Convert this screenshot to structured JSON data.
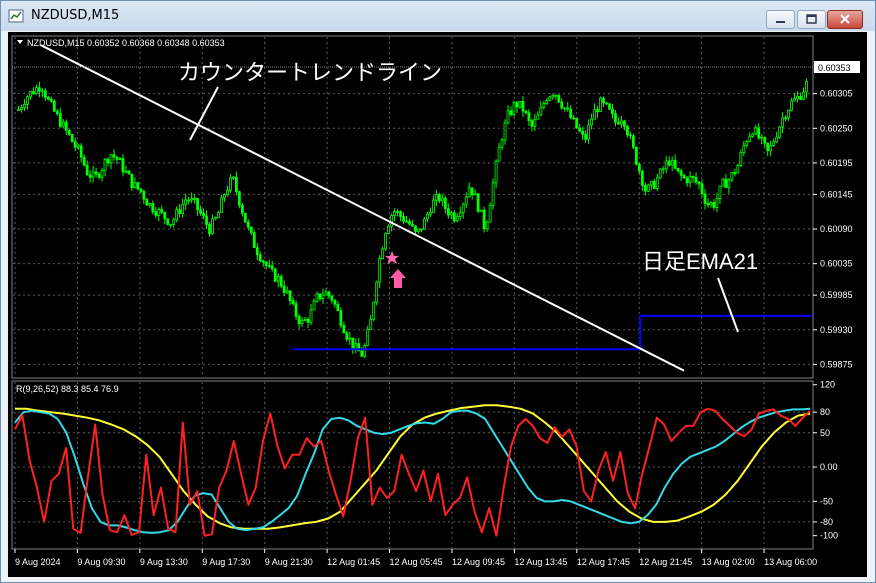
{
  "window": {
    "title": "NZDUSD,M15"
  },
  "colors": {
    "bull": "#00ff00",
    "trendline": "#ffffff",
    "ema": "#0000ff",
    "rsi_fast": "#ff2020",
    "rsi_mid": "#33d9e8",
    "rsi_slow": "#ffff33",
    "grid": "#5a5a5a",
    "marker_star": "#ff69b4",
    "marker_arrow": "#ff5aa5"
  },
  "main_chart": {
    "header": "NZDUSD,M15  0.60352 0.60368 0.60348 0.60353",
    "current_price": "0.60353",
    "price_ticks": [
      "0.60305",
      "0.60250",
      "0.60195",
      "0.60145",
      "0.60090",
      "0.60035",
      "0.59985",
      "0.59930",
      "0.59875"
    ],
    "annotation_trend": "カウンタートレンドライン",
    "annotation_ema": "日足EMA21"
  },
  "sub_chart": {
    "header": "R(9,26,52) 88.3 85.4 76.9",
    "ticks": [
      "120",
      "80",
      "50",
      "0.00",
      "-50",
      "-80",
      "-100"
    ]
  },
  "time_axis": [
    "9 Aug 2024",
    "9 Aug 09:30",
    "9 Aug 13:30",
    "9 Aug 17:30",
    "9 Aug 21:30",
    "12 Aug 01:45",
    "12 Aug 05:45",
    "12 Aug 09:45",
    "12 Aug 13:45",
    "12 Aug 17:45",
    "12 Aug 21:45",
    "13 Aug 02:00",
    "13 Aug 06:00"
  ],
  "chart_data": {
    "type": "candlestick",
    "symbol": "NZDUSD",
    "timeframe": "M15",
    "y_range": [
      0.59855,
      0.60395
    ],
    "close_series": [
      0.6028,
      0.603,
      0.6031,
      0.6032,
      0.6029,
      0.6027,
      0.6025,
      0.6023,
      0.6021,
      0.6018,
      0.6017,
      0.6019,
      0.6021,
      0.602,
      0.6018,
      0.6016,
      0.6015,
      0.6013,
      0.6012,
      0.6011,
      0.601,
      0.6012,
      0.6014,
      0.6013,
      0.6011,
      0.6009,
      0.6011,
      0.6015,
      0.6017,
      0.6013,
      0.6009,
      0.6006,
      0.6004,
      0.6002,
      0.6001,
      0.5999,
      0.5996,
      0.5994,
      0.5995,
      0.5998,
      0.5999,
      0.5998,
      0.5995,
      0.5992,
      0.599,
      0.5989,
      0.5994,
      0.6003,
      0.6009,
      0.6012,
      0.6011,
      0.601,
      0.6008,
      0.601,
      0.6013,
      0.6014,
      0.6012,
      0.6011,
      0.6013,
      0.6016,
      0.6013,
      0.6009,
      0.6016,
      0.6023,
      0.6027,
      0.6029,
      0.6028,
      0.6025,
      0.6027,
      0.603,
      0.6031,
      0.6029,
      0.6027,
      0.6025,
      0.6023,
      0.6027,
      0.6029,
      0.6028,
      0.6026,
      0.6027,
      0.6023,
      0.6019,
      0.6015,
      0.6016,
      0.6018,
      0.602,
      0.6018,
      0.6017,
      0.6017,
      0.6016,
      0.6013,
      0.6013,
      0.6016,
      0.6017,
      0.6019,
      0.6023,
      0.6025,
      0.6023,
      0.6021,
      0.6024,
      0.6027,
      0.6029,
      0.603,
      0.6032
    ],
    "ema_steps": [
      {
        "from": 0.35,
        "to": 0.785,
        "value": 0.59899
      },
      {
        "from": 0.785,
        "to": 1.0,
        "value": 0.59952
      }
    ],
    "trendline": {
      "start": 0.60382,
      "end": 0.59865
    },
    "rsi": {
      "fast": [
        55,
        76,
        10,
        -30,
        -80,
        -20,
        -10,
        28,
        -90,
        -96,
        -15,
        62,
        -40,
        -92,
        -95,
        -70,
        -99,
        -95,
        18,
        -70,
        -30,
        -90,
        -95,
        65,
        -55,
        -35,
        -100,
        -98,
        -30,
        -5,
        38,
        -10,
        -55,
        -30,
        38,
        78,
        30,
        -2,
        18,
        18,
        42,
        30,
        38,
        -5,
        -40,
        -72,
        -20,
        42,
        72,
        -55,
        -30,
        -45,
        -35,
        18,
        -10,
        -35,
        -5,
        -50,
        -10,
        -70,
        -55,
        -45,
        -15,
        -65,
        -95,
        -60,
        -100,
        -30,
        30,
        60,
        70,
        60,
        42,
        35,
        58,
        44,
        55,
        30,
        -35,
        -50,
        -5,
        22,
        -20,
        22,
        -38,
        -60,
        -10,
        30,
        72,
        62,
        38,
        50,
        60,
        60,
        80,
        85,
        82,
        70,
        60,
        50,
        45,
        55,
        78,
        82,
        84,
        75,
        70,
        60,
        72,
        82
      ],
      "mid": [
        65,
        80,
        82,
        80,
        78,
        70,
        50,
        15,
        -25,
        -60,
        -80,
        -85,
        -85,
        -88,
        -92,
        -95,
        -96,
        -95,
        -92,
        -80,
        -60,
        -42,
        -38,
        -40,
        -60,
        -80,
        -90,
        -92,
        -90,
        -88,
        -80,
        -70,
        -60,
        -42,
        -10,
        20,
        55,
        70,
        72,
        68,
        60,
        55,
        50,
        48,
        50,
        55,
        60,
        64,
        65,
        63,
        70,
        80,
        82,
        82,
        78,
        70,
        50,
        30,
        10,
        -10,
        -30,
        -45,
        -50,
        -50,
        -48,
        -50,
        -55,
        -60,
        -65,
        -70,
        -75,
        -80,
        -82,
        -80,
        -70,
        -55,
        -30,
        -10,
        5,
        15,
        20,
        25,
        30,
        38,
        48,
        58,
        66,
        72,
        76,
        80,
        82,
        84,
        84,
        85
      ],
      "slow": [
        85,
        85,
        82,
        80,
        78,
        75,
        72,
        68,
        62,
        55,
        45,
        32,
        15,
        -10,
        -35,
        -55,
        -72,
        -82,
        -88,
        -90,
        -90,
        -90,
        -88,
        -85,
        -82,
        -80,
        -75,
        -65,
        -45,
        -25,
        -5,
        20,
        45,
        62,
        72,
        78,
        82,
        86,
        88,
        90,
        90,
        88,
        85,
        78,
        65,
        50,
        30,
        10,
        -10,
        -30,
        -50,
        -65,
        -75,
        -80,
        -80,
        -78,
        -72,
        -65,
        -55,
        -40,
        -20,
        5,
        30,
        50,
        65,
        75,
        78
      ]
    }
  }
}
